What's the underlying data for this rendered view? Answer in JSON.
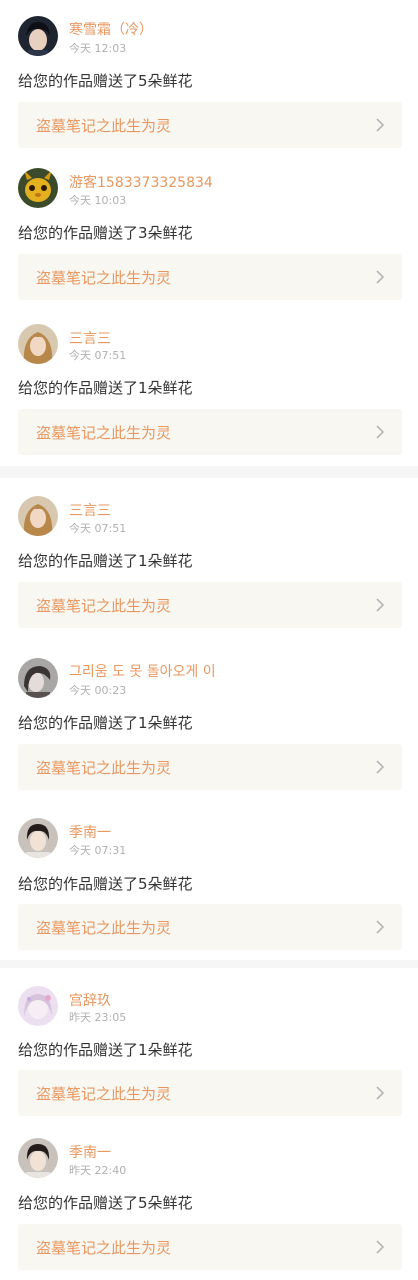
{
  "gifts": [
    {
      "username": "寒雪霜（冷）",
      "time": "今天 12:03",
      "message": "给您的作品赠送了5朵鲜花",
      "work_title": "盗墓笔记之此生为灵",
      "avatar_icon": "avatar-dark-hair-portrait"
    },
    {
      "username": "游客1583373325834",
      "time": "今天 10:03",
      "message": "给您的作品赠送了3朵鲜花",
      "work_title": "盗墓笔记之此生为灵",
      "avatar_icon": "avatar-yellow-creature"
    },
    {
      "username": "三言三",
      "time": "今天 07:51",
      "message": "给您的作品赠送了1朵鲜花",
      "work_title": "盗墓笔记之此生为灵",
      "avatar_icon": "avatar-blonde-portrait"
    },
    {
      "username": "三言三",
      "time": "今天 07:51",
      "message": "给您的作品赠送了1朵鲜花",
      "work_title": "盗墓笔记之此生为灵",
      "avatar_icon": "avatar-blonde-portrait"
    },
    {
      "username": "그리움 도 못 돌아오게 이",
      "time": "今天 00:23",
      "message": "给您的作品赠送了1朵鲜花",
      "work_title": "盗墓笔记之此生为灵",
      "avatar_icon": "avatar-grey-portrait"
    },
    {
      "username": "季南一",
      "time": "今天 07:31",
      "message": "给您的作品赠送了5朵鲜花",
      "work_title": "盗墓笔记之此生为灵",
      "avatar_icon": "avatar-boy-portrait"
    },
    {
      "username": "宫辞玖",
      "time": "昨天 23:05",
      "message": "给您的作品赠送了1朵鲜花",
      "work_title": "盗墓笔记之此生为灵",
      "avatar_icon": "avatar-pastel-anime"
    },
    {
      "username": "季南一",
      "time": "昨天 22:40",
      "message": "给您的作品赠送了5朵鲜花",
      "work_title": "盗墓笔记之此生为灵",
      "avatar_icon": "avatar-boy-portrait"
    }
  ],
  "colors": {
    "accent": "#e9975f",
    "text": "#333333",
    "muted": "#b0b0b0",
    "work_bg": "#f8f7f2",
    "separator": "#f6f6f6"
  }
}
